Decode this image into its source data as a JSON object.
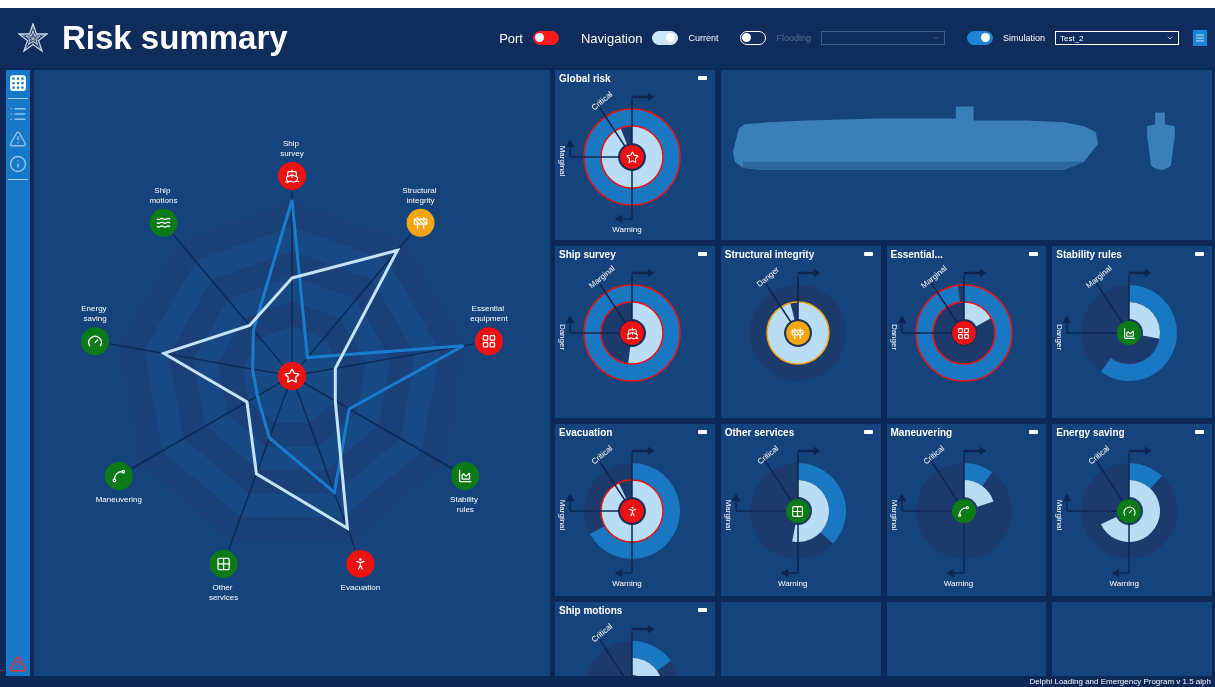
{
  "header": {
    "title": "Risk summary",
    "toggles": [
      {
        "before": "Port",
        "on": false,
        "color": "#ff1a1a"
      },
      {
        "before": "Navigation",
        "after": "Current",
        "on": true
      },
      {
        "after": "Flooding",
        "on": false,
        "disabled": true,
        "dropdown": {
          "disabled": true
        }
      },
      {
        "after": "Simulation",
        "on": true,
        "dropdown": {
          "value": "Test_2"
        }
      }
    ]
  },
  "sidebar": {
    "items": [
      {
        "kind": "grid",
        "selected": true
      },
      {
        "kind": "list",
        "selected": false
      },
      {
        "kind": "warning",
        "selected": false
      },
      {
        "kind": "info",
        "selected": false
      }
    ],
    "alert": true
  },
  "radar": {
    "categories": [
      {
        "label": "Ship survey",
        "color": "#ee1111"
      },
      {
        "label": "Structural integrity",
        "color": "#f5a50f"
      },
      {
        "label": "Essential equipment",
        "color": "#ee1111"
      },
      {
        "label": "Stability rules",
        "color": "#0c7a16"
      },
      {
        "label": "Evacuation",
        "color": "#ee1111"
      },
      {
        "label": "Other services",
        "color": "#0c7a16"
      },
      {
        "label": "Maneuvering",
        "color": "#0c7a16"
      },
      {
        "label": "Energy saving",
        "color": "#0c7a16"
      },
      {
        "label": "Ship motions",
        "color": "#0c7a16"
      }
    ]
  },
  "cards": [
    {
      "title": "Global risk",
      "color": "#ee1111",
      "outlined": true,
      "labels": {
        "diagonal": "Critical",
        "left": "Marginal",
        "bottom": "Warning"
      }
    },
    {
      "title": "Ship survey",
      "color": "#ee1111",
      "outlined": true,
      "labels": {
        "diagonal": "Marginal",
        "left": "Danger"
      }
    },
    {
      "title": "Structural integrity",
      "color": "#f5a50f",
      "outlined": true,
      "labels": {
        "diagonal": "Danger"
      }
    },
    {
      "title": "Essential...",
      "color": "#ee1111",
      "outlined": true,
      "labels": {
        "diagonal": "Marginal",
        "left": "Danger"
      }
    },
    {
      "title": "Stability rules",
      "color": "#0c7a16",
      "outlined": false,
      "labels": {
        "diagonal": "Marginal",
        "left": "Danger"
      }
    },
    {
      "title": "Evacuation",
      "color": "#ee1111",
      "outlined": true,
      "labels": {
        "diagonal": "Critical",
        "left": "Marginal",
        "bottom": "Warning"
      }
    },
    {
      "title": "Other services",
      "color": "#0c7a16",
      "outlined": false,
      "labels": {
        "diagonal": "Critical",
        "left": "Marginal",
        "bottom": "Warning"
      }
    },
    {
      "title": "Maneuvering",
      "color": "#0c7a16",
      "outlined": false,
      "labels": {
        "diagonal": "Critical",
        "left": "Marginal",
        "bottom": "Warning"
      }
    },
    {
      "title": "Energy saving",
      "color": "#0c7a16",
      "outlined": false,
      "labels": {
        "diagonal": "Critical",
        "left": "Marginal",
        "bottom": "Warning"
      }
    },
    {
      "title": "Ship motions",
      "labels": {
        "diagonal": "Critical"
      }
    }
  ],
  "status_bar": "Delphi Loading and Emergency Program v 1.5 alph"
}
